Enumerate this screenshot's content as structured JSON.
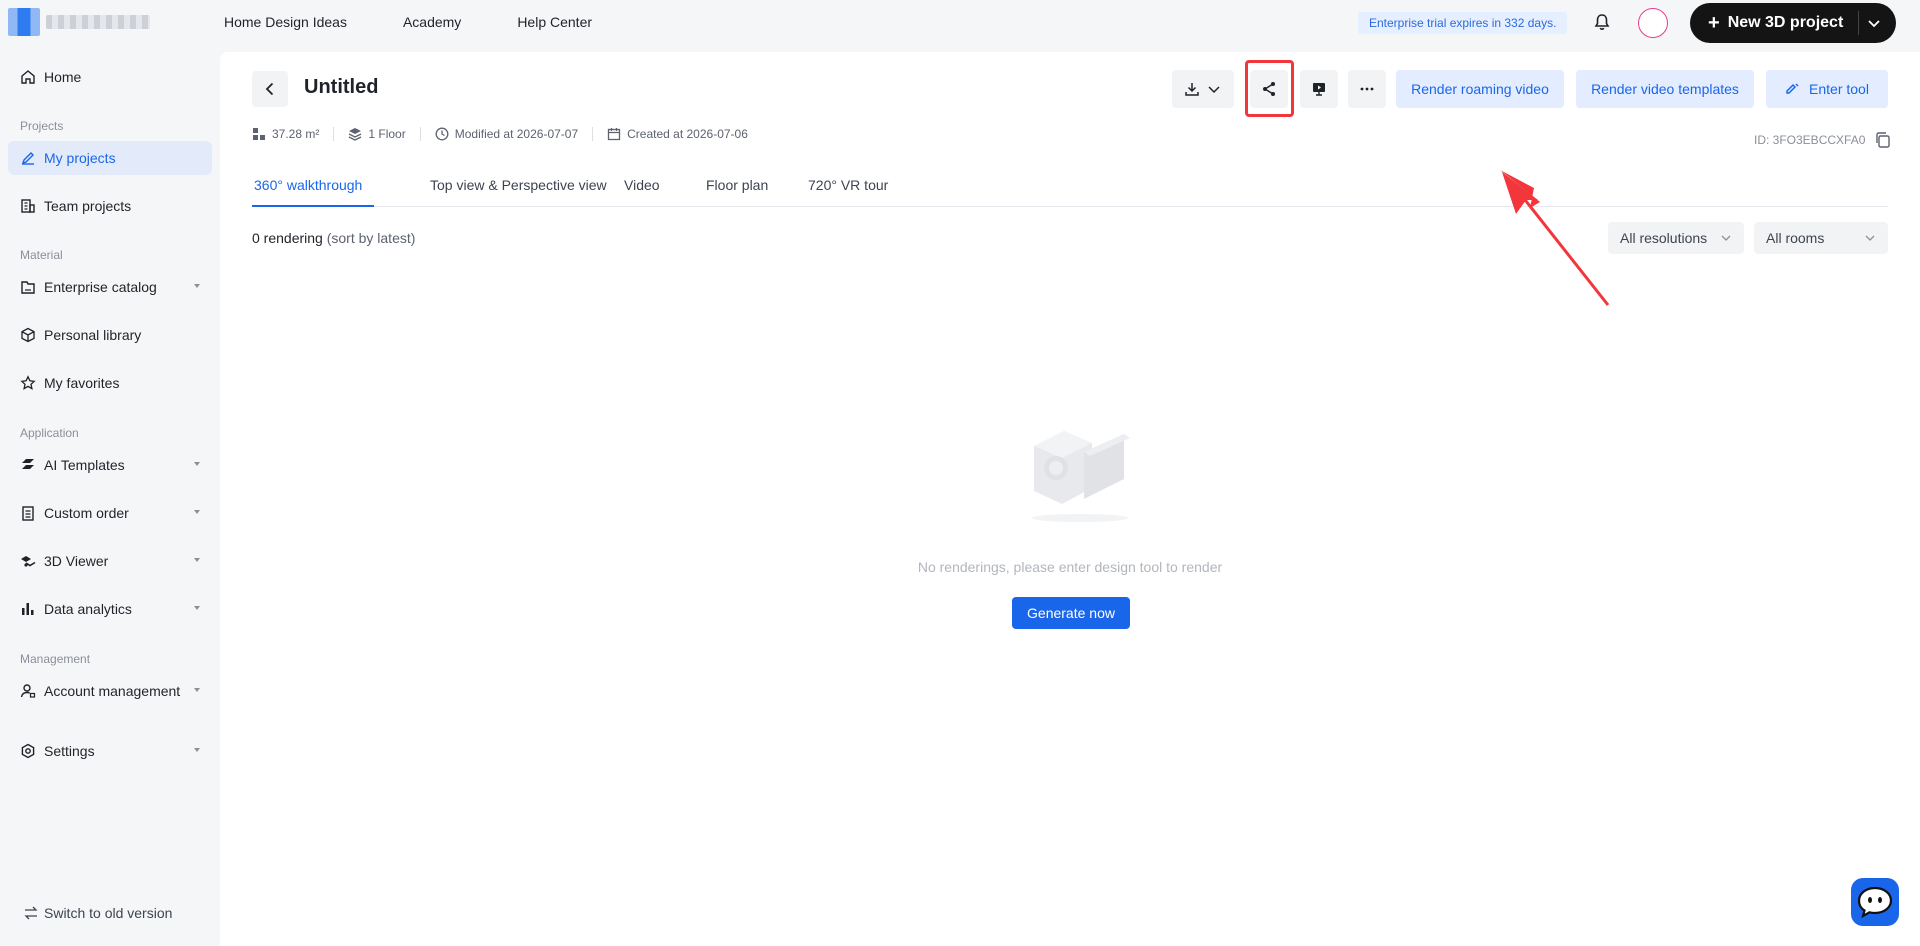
{
  "topbar": {
    "nav": [
      "Home Design Ideas",
      "Academy",
      "Help Center"
    ],
    "trial_badge": "Enterprise trial expires in 332 days.",
    "new_project_label": "New 3D project"
  },
  "sidebar": {
    "home": "Home",
    "section_projects": "Projects",
    "my_projects": "My projects",
    "team_projects": "Team projects",
    "section_material": "Material",
    "enterprise_catalog": "Enterprise catalog",
    "personal_library": "Personal library",
    "my_favorites": "My favorites",
    "section_application": "Application",
    "ai_templates": "AI Templates",
    "custom_order": "Custom order",
    "viewer_3d": "3D Viewer",
    "data_analytics": "Data analytics",
    "section_management": "Management",
    "account_management": "Account management",
    "settings": "Settings",
    "switch_old": "Switch to old version"
  },
  "project": {
    "title": "Untitled",
    "area": "37.28 m²",
    "floors": "1 Floor",
    "modified": "Modified at 2026-07-07",
    "created": "Created at 2026-07-06",
    "id": "ID: 3FO3EBCCXFA0"
  },
  "toolbar": {
    "render_roaming": "Render roaming video",
    "render_templates": "Render video templates",
    "enter_tool": "Enter tool"
  },
  "tabs": [
    "360° walkthrough",
    "Top view & Perspective view",
    "Video",
    "Floor plan",
    "720° VR tour"
  ],
  "list": {
    "count": "0 rendering",
    "sort": "(sort by latest)",
    "resolution_filter": "All resolutions",
    "room_filter": "All rooms"
  },
  "empty": {
    "message": "No renderings, please enter design tool to render",
    "cta": "Generate now"
  },
  "colors": {
    "accent": "#1a66ea",
    "highlight": "#f2363c"
  }
}
